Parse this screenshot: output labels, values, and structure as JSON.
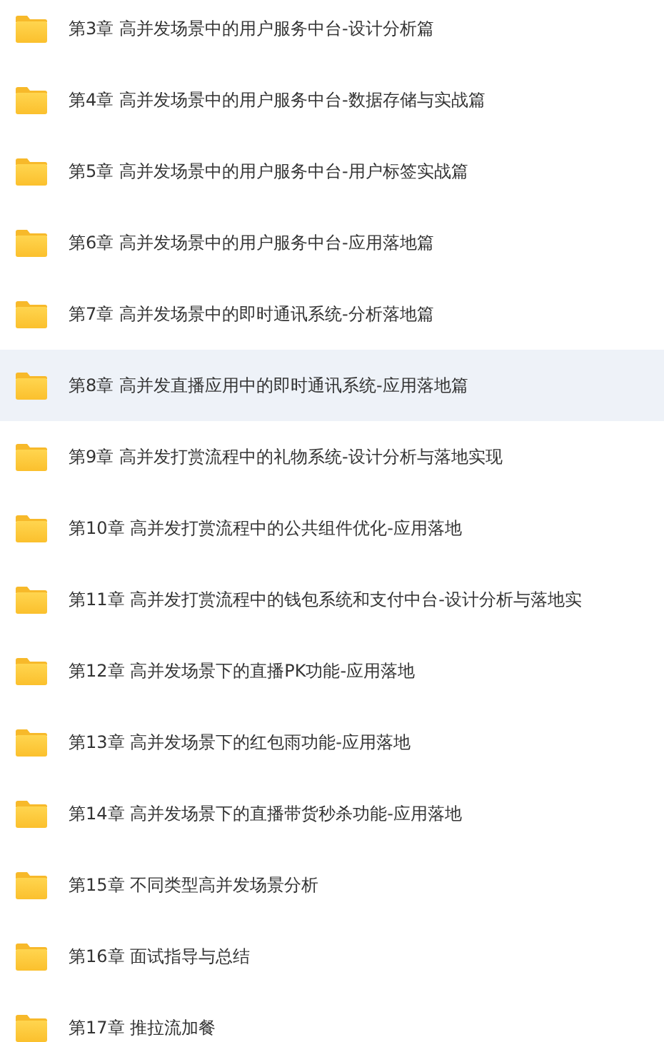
{
  "folders": [
    {
      "name": "第3章 高并发场景中的用户服务中台-设计分析篇",
      "selected": false
    },
    {
      "name": "第4章 高并发场景中的用户服务中台-数据存储与实战篇",
      "selected": false
    },
    {
      "name": "第5章 高并发场景中的用户服务中台-用户标签实战篇",
      "selected": false
    },
    {
      "name": "第6章 高并发场景中的用户服务中台-应用落地篇",
      "selected": false
    },
    {
      "name": "第7章 高并发场景中的即时通讯系统-分析落地篇",
      "selected": false
    },
    {
      "name": "第8章 高并发直播应用中的即时通讯系统-应用落地篇",
      "selected": true
    },
    {
      "name": "第9章 高并发打赏流程中的礼物系统-设计分析与落地实现",
      "selected": false
    },
    {
      "name": "第10章 高并发打赏流程中的公共组件优化-应用落地",
      "selected": false
    },
    {
      "name": "第11章 高并发打赏流程中的钱包系统和支付中台-设计分析与落地实",
      "selected": false
    },
    {
      "name": "第12章 高并发场景下的直播PK功能-应用落地",
      "selected": false
    },
    {
      "name": "第13章 高并发场景下的红包雨功能-应用落地",
      "selected": false
    },
    {
      "name": "第14章 高并发场景下的直播带货秒杀功能-应用落地",
      "selected": false
    },
    {
      "name": "第15章 不同类型高并发场景分析",
      "selected": false
    },
    {
      "name": "第16章 面试指导与总结",
      "selected": false
    },
    {
      "name": "第17章 推拉流加餐",
      "selected": false
    }
  ]
}
